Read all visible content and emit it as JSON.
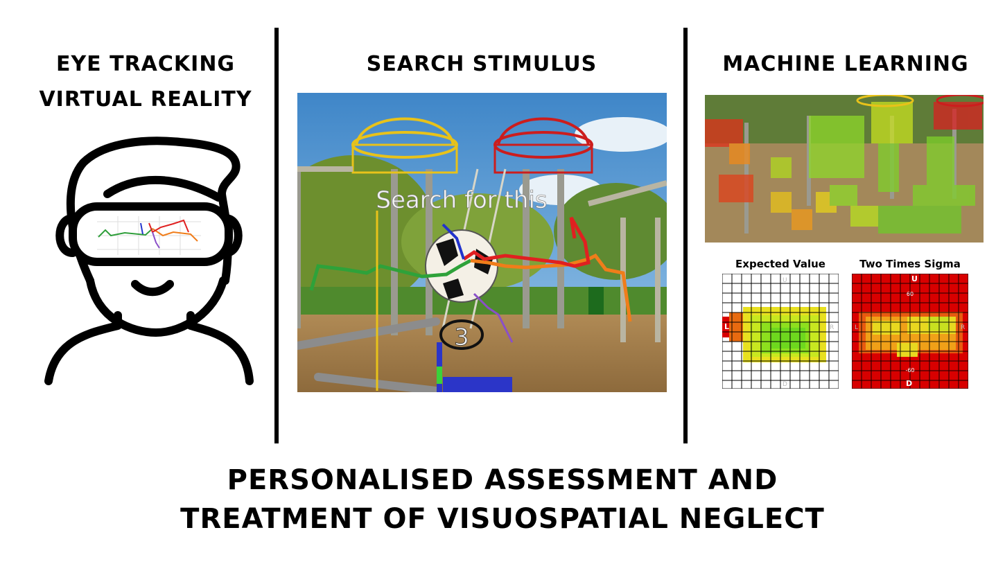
{
  "columns": {
    "left": {
      "title_line1": "EYE TRACKING",
      "title_line2": "VIRTUAL REALITY"
    },
    "middle": {
      "title": "SEARCH STIMULUS",
      "overlay_text": "Search for this",
      "counter": "3"
    },
    "right": {
      "title": "MACHINE LEARNING"
    }
  },
  "heatmaps": {
    "expected": {
      "label": "Expected Value",
      "marker_left": "L",
      "marker_right": "R",
      "marker_up": "U",
      "marker_down": "D"
    },
    "sigma": {
      "label": "Two Times Sigma",
      "marker_left": "L",
      "marker_right": "R",
      "marker_up": "U",
      "marker_down": "D",
      "tick_60": "60",
      "tick_neg60": "-60"
    }
  },
  "footer": {
    "line1": "PERSONALISED ASSESSMENT AND",
    "line2": "TREATMENT OF VISUOSPATIAL NEGLECT"
  },
  "colors": {
    "ink": "#000000",
    "gaze_green": "#2e9e3a",
    "gaze_orange": "#f07d1a",
    "gaze_red": "#e02020",
    "gaze_purple": "#8a4fc8",
    "heat_red": "#d80000",
    "heat_green": "#7ee01e"
  }
}
